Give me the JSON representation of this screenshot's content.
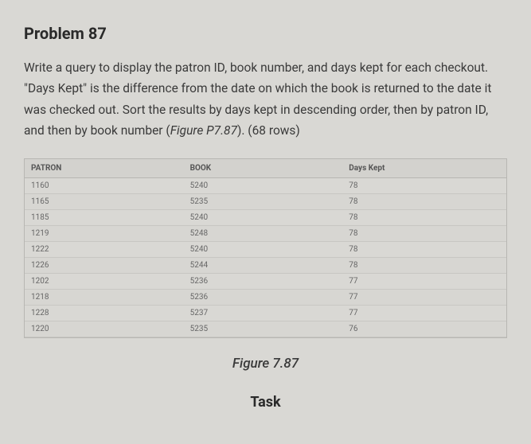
{
  "title": "Problem 87",
  "description_pre": "Write a query to display the patron ID, book number, and days kept for each checkout. \"Days Kept\" is the difference from the date on which the book is returned to the date it was checked out. Sort the results by days kept in descending order, then by patron ID, and then by book number (",
  "description_em": "Figure P7.87",
  "description_post": "). (68 rows)",
  "headers": {
    "patron": "PATRON",
    "book": "BOOK",
    "days": "Days Kept"
  },
  "chart_data": {
    "type": "table",
    "columns": [
      "PATRON",
      "BOOK",
      "Days Kept"
    ],
    "rows": [
      {
        "patron": "1160",
        "book": "5240",
        "days": "78"
      },
      {
        "patron": "1165",
        "book": "5235",
        "days": "78"
      },
      {
        "patron": "1185",
        "book": "5240",
        "days": "78"
      },
      {
        "patron": "1219",
        "book": "5248",
        "days": "78"
      },
      {
        "patron": "1222",
        "book": "5240",
        "days": "78"
      },
      {
        "patron": "1226",
        "book": "5244",
        "days": "78"
      },
      {
        "patron": "1202",
        "book": "5236",
        "days": "77"
      },
      {
        "patron": "1218",
        "book": "5236",
        "days": "77"
      },
      {
        "patron": "1228",
        "book": "5237",
        "days": "77"
      },
      {
        "patron": "1220",
        "book": "5235",
        "days": "76"
      }
    ]
  },
  "figure_caption": "Figure 7.87",
  "task_heading": "Task"
}
